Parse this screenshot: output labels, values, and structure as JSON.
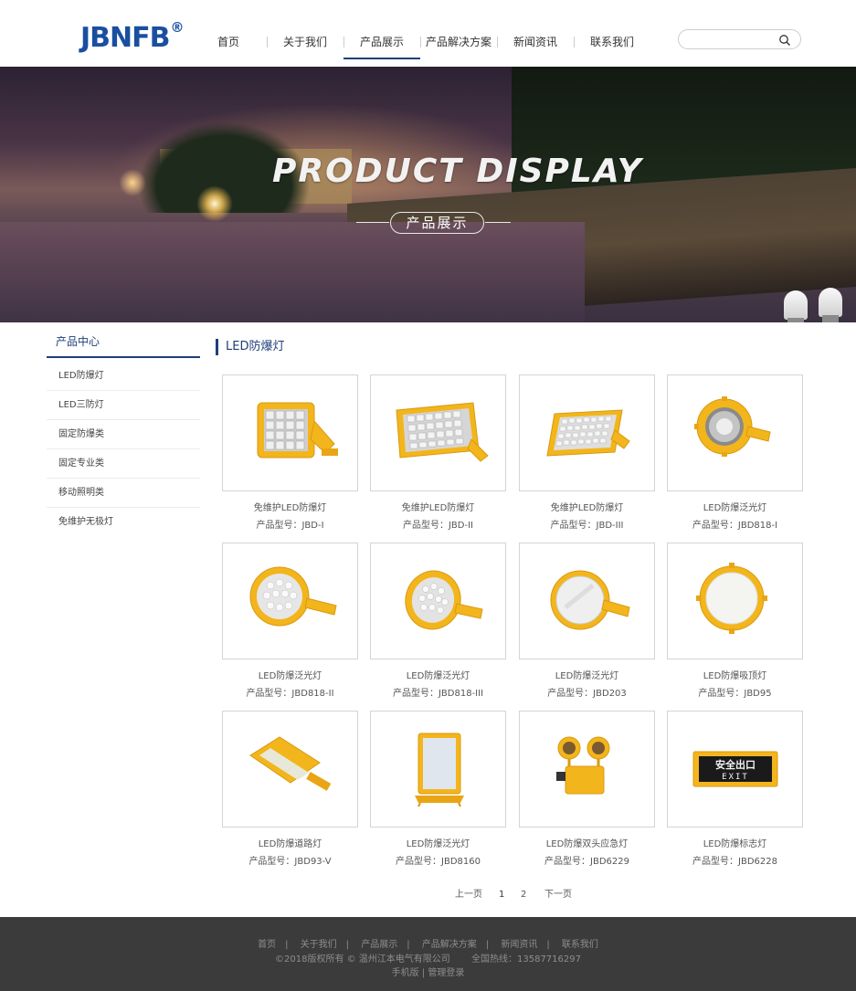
{
  "header": {
    "logo_text": "JBNFB",
    "logo_reg": "®",
    "nav": [
      "首页",
      "关于我们",
      "产品展示",
      "产品解决方案",
      "新闻资讯",
      "联系我们"
    ],
    "active_nav": "产品展示",
    "search_placeholder": ""
  },
  "banner": {
    "title": "PRODUCT DISPLAY",
    "subtitle": "产品展示"
  },
  "sidebar": {
    "heading": "产品中心",
    "items": [
      "LED防爆灯",
      "LED三防灯",
      "固定防爆类",
      "固定专业类",
      "移动照明类",
      "免维护无极灯"
    ]
  },
  "main": {
    "section_title": "LED防爆灯",
    "products": [
      {
        "name": "免维护LED防爆灯",
        "model": "产品型号：JBD-I",
        "icon": "floodlight-square-icon"
      },
      {
        "name": "免维护LED防爆灯",
        "model": "产品型号：JBD-II",
        "icon": "floodlight-wide-icon"
      },
      {
        "name": "免维护LED防爆灯",
        "model": "产品型号：JBD-III",
        "icon": "floodlight-flat-icon"
      },
      {
        "name": "LED防爆泛光灯",
        "model": "产品型号：JBD818-I",
        "icon": "round-floodlight-icon"
      },
      {
        "name": "LED防爆泛光灯",
        "model": "产品型号：JBD818-II",
        "icon": "round-floodlight-icon"
      },
      {
        "name": "LED防爆泛光灯",
        "model": "产品型号：JBD818-III",
        "icon": "round-floodlight-icon"
      },
      {
        "name": "LED防爆泛光灯",
        "model": "产品型号：JBD203",
        "icon": "round-flat-light-icon"
      },
      {
        "name": "LED防爆吸顶灯",
        "model": "产品型号：JBD95",
        "icon": "ceiling-light-icon"
      },
      {
        "name": "LED防爆道路灯",
        "model": "产品型号：JBD93-V",
        "icon": "street-light-icon"
      },
      {
        "name": "LED防爆泛光灯",
        "model": "产品型号：JBD8160",
        "icon": "panel-floodlight-icon"
      },
      {
        "name": "LED防爆双头应急灯",
        "model": "产品型号：JBD6229",
        "icon": "emergency-light-icon"
      },
      {
        "name": "LED防爆标志灯",
        "model": "产品型号：JBD6228",
        "icon": "exit-sign-icon"
      }
    ],
    "exit_sign_text": "安全出口",
    "exit_sign_en": "EXIT"
  },
  "pager": {
    "prev": "上一页",
    "pages": [
      "1",
      "2"
    ],
    "next": "下一页"
  },
  "footer": {
    "nav": [
      "首页",
      "关于我们",
      "产品展示",
      "产品解决方案",
      "新闻资讯",
      "联系我们"
    ],
    "copyright": "©2018版权所有 © 温州江本电气有限公司",
    "hotline": "全国热线：13587716297",
    "mobile": "手机版",
    "admin": "管理登录"
  },
  "colors": {
    "brand": "#1a4fa0",
    "accent": "#1e3f7a",
    "product_yellow": "#f3b51c",
    "footer_bg": "#3b3b3b"
  }
}
